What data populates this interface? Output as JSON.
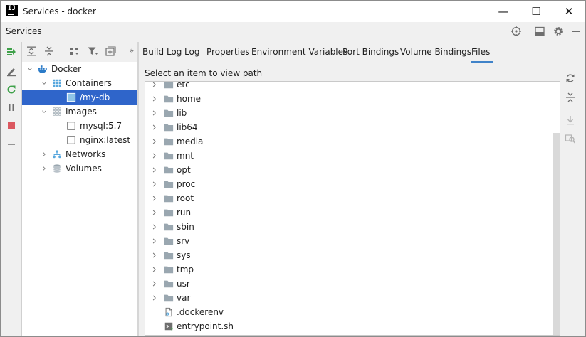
{
  "window": {
    "title": "Services - docker",
    "app_icon_text": "IJ",
    "minimize_glyph": "—",
    "maximize_glyph": "☐",
    "close_glyph": "✕"
  },
  "tool_window": {
    "title": "Services",
    "header_icons": [
      "target-icon",
      "layout-icon",
      "gear-icon",
      "minimize-icon"
    ]
  },
  "left_actions": [
    "deploy-icon",
    "edit-icon",
    "restart-icon",
    "pause-icon",
    "stop-icon",
    "remove-icon"
  ],
  "tree_toolbar": {
    "icons": [
      "expand-all-icon",
      "collapse-all-icon",
      "group-icon",
      "filter-icon",
      "add-service-icon"
    ],
    "more_glyph": "»"
  },
  "tree": [
    {
      "label": "Docker",
      "level": 0,
      "chevron": "down",
      "icon": "docker-icon"
    },
    {
      "label": "Containers",
      "level": 1,
      "chevron": "down",
      "icon": "containers-icon"
    },
    {
      "label": "/my-db",
      "level": 2,
      "chevron": "none",
      "icon": "container-icon",
      "selected": true
    },
    {
      "label": "Images",
      "level": 1,
      "chevron": "down",
      "icon": "images-icon"
    },
    {
      "label": "mysql:5.7",
      "level": 2,
      "chevron": "none",
      "icon": "image-icon"
    },
    {
      "label": "nginx:latest",
      "level": 2,
      "chevron": "none",
      "icon": "image-icon"
    },
    {
      "label": "Networks",
      "level": 1,
      "chevron": "right",
      "icon": "networks-icon"
    },
    {
      "label": "Volumes",
      "level": 1,
      "chevron": "right",
      "icon": "volumes-icon"
    }
  ],
  "tabs": [
    {
      "label": "Build Log"
    },
    {
      "label": "Log"
    },
    {
      "label": "Properties"
    },
    {
      "label": "Environment Variables"
    },
    {
      "label": "Port Bindings"
    },
    {
      "label": "Volume Bindings"
    },
    {
      "label": "Files",
      "active": true
    }
  ],
  "files_panel": {
    "hint": "Select an item to view path",
    "entries": [
      {
        "name": "etc",
        "type": "folder"
      },
      {
        "name": "home",
        "type": "folder"
      },
      {
        "name": "lib",
        "type": "folder"
      },
      {
        "name": "lib64",
        "type": "folder"
      },
      {
        "name": "media",
        "type": "folder"
      },
      {
        "name": "mnt",
        "type": "folder"
      },
      {
        "name": "opt",
        "type": "folder"
      },
      {
        "name": "proc",
        "type": "folder"
      },
      {
        "name": "root",
        "type": "folder"
      },
      {
        "name": "run",
        "type": "folder"
      },
      {
        "name": "sbin",
        "type": "folder"
      },
      {
        "name": "srv",
        "type": "folder"
      },
      {
        "name": "sys",
        "type": "folder"
      },
      {
        "name": "tmp",
        "type": "folder"
      },
      {
        "name": "usr",
        "type": "folder"
      },
      {
        "name": "var",
        "type": "folder"
      },
      {
        "name": ".dockerenv",
        "type": "file"
      },
      {
        "name": "entrypoint.sh",
        "type": "script"
      }
    ],
    "side_icons": [
      "refresh-icon",
      "collapse-icon",
      "download-icon",
      "find-icon"
    ]
  },
  "colors": {
    "selection": "#2f65ca",
    "active_tab_underline": "#4083c9",
    "folder": "#9aa7b0",
    "run_green": "#3fa14a",
    "stop_red": "#db5860",
    "docker_blue": "#2b7bc8"
  }
}
